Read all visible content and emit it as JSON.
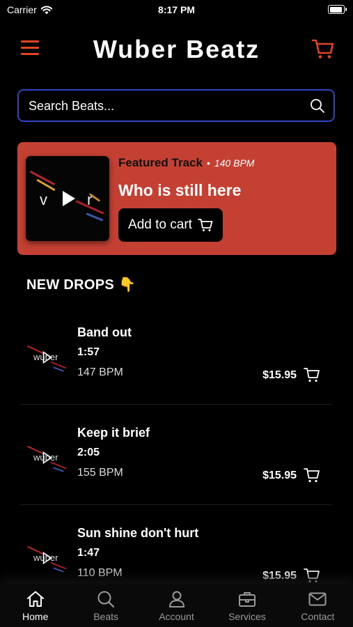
{
  "status": {
    "carrier": "Carrier",
    "time": "8:17 PM"
  },
  "header": {
    "title": "Wuber Beatz",
    "accent": "#e04422"
  },
  "search": {
    "placeholder": "Search Beats...",
    "value": ""
  },
  "featured": {
    "label": "Featured Track",
    "separator": "•",
    "bpm": "140 BPM",
    "title": "Who is still here",
    "add_to_cart": "Add to cart",
    "art_letters": [
      "v",
      "r"
    ],
    "background": "#c44032"
  },
  "section": {
    "title": "NEW DROPS",
    "emoji": "👇"
  },
  "thumb_text": "wuber",
  "tracks": [
    {
      "name": "Band out",
      "duration": "1:57",
      "bpm": "147 BPM",
      "price": "$15.95"
    },
    {
      "name": "Keep it brief",
      "duration": "2:05",
      "bpm": "155 BPM",
      "price": "$15.95"
    },
    {
      "name": "Sun shine don't hurt",
      "duration": "1:47",
      "bpm": "110 BPM",
      "price": "$15.95"
    }
  ],
  "tabs": [
    {
      "label": "Home",
      "icon": "home-icon",
      "active": true
    },
    {
      "label": "Beats",
      "icon": "search-icon",
      "active": false
    },
    {
      "label": "Account",
      "icon": "user-icon",
      "active": false
    },
    {
      "label": "Services",
      "icon": "briefcase-icon",
      "active": false
    },
    {
      "label": "Contact",
      "icon": "mail-icon",
      "active": false
    }
  ]
}
